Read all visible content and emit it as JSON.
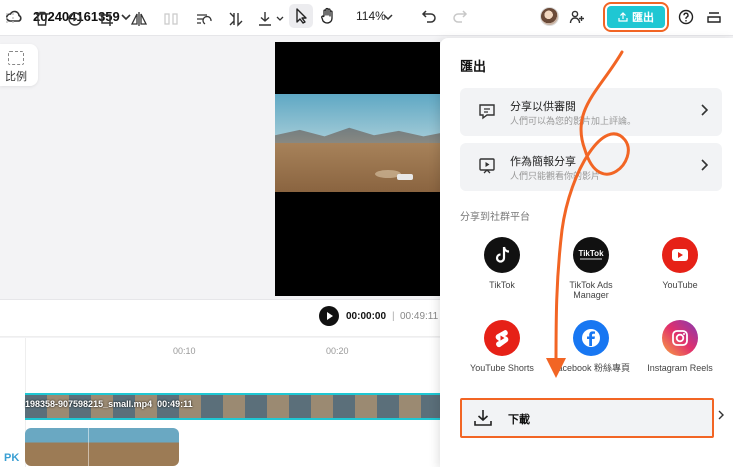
{
  "header": {
    "project_title": "202404161359",
    "zoom": "114%",
    "export_label": "匯出",
    "accent_color": "#1fc7d3",
    "icons": [
      "cloud-icon",
      "chevron-down-icon",
      "pointer-icon",
      "hand-icon",
      "undo-icon",
      "redo-icon",
      "add-user-icon",
      "upload-icon",
      "help-icon",
      "menu-icon"
    ]
  },
  "left_panel": {
    "ratio_label": "比例"
  },
  "timeline": {
    "current_time": "00:00:00",
    "separator": "|",
    "total_time": "00:49:11",
    "ticks": [
      "00:10",
      "00:20"
    ],
    "clip_label": "198358-907598215_small.mp4",
    "clip_duration": "00:49:11",
    "watermark": "PK"
  },
  "export_panel": {
    "title": "匯出",
    "share_review": {
      "title": "分享以供審閱",
      "subtitle": "人們可以為您的影片加上評論。"
    },
    "share_presentation": {
      "title": "作為簡報分享",
      "subtitle": "人們只能觀看你的影片"
    },
    "social_section": "分享到社群平台",
    "social": [
      {
        "name": "TikTok"
      },
      {
        "name": "TikTok Ads Manager"
      },
      {
        "name": "YouTube"
      },
      {
        "name": "YouTube Shorts"
      },
      {
        "name": "Facebook 粉絲專頁"
      },
      {
        "name": "Instagram Reels"
      }
    ],
    "download_label": "下載"
  },
  "annotation_color": "#f26524"
}
